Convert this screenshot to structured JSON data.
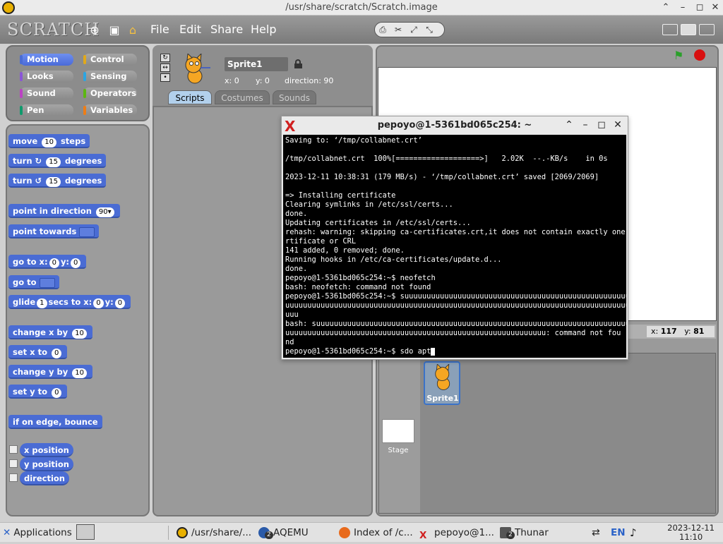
{
  "window": {
    "title": "/usr/share/scratch/Scratch.image",
    "controls": [
      "⌃",
      "–",
      "◻",
      "✕"
    ]
  },
  "scratch": {
    "logo": "SCRATCH",
    "menus": [
      "File",
      "Edit",
      "Share",
      "Help"
    ],
    "categories": [
      "Motion",
      "Control",
      "Looks",
      "Sensing",
      "Sound",
      "Operators",
      "Pen",
      "Variables"
    ],
    "category_colors": [
      "#4a6cd4",
      "#e1a91a",
      "#8a55d7",
      "#2ca5e2",
      "#bb42c3",
      "#5cb712",
      "#0e9a6c",
      "#ee7d16"
    ],
    "blocks": {
      "move": {
        "pre": "move",
        "val": "10",
        "post": "steps"
      },
      "turn_cw": {
        "pre": "turn ↻",
        "val": "15",
        "post": "degrees"
      },
      "turn_ccw": {
        "pre": "turn ↺",
        "val": "15",
        "post": "degrees"
      },
      "point_dir": {
        "pre": "point in direction",
        "val": "90▾"
      },
      "point_towards": {
        "pre": "point towards"
      },
      "goto_xy": {
        "pre": "go to x:",
        "x": "0",
        "mid": "y:",
        "y": "0"
      },
      "goto": {
        "pre": "go to"
      },
      "glide": {
        "pre": "glide",
        "val": "1",
        "mid": "secs to x:",
        "x": "0",
        "mid2": "y:",
        "y": "0"
      },
      "change_x": {
        "pre": "change x by",
        "val": "10"
      },
      "set_x": {
        "pre": "set x to",
        "val": "0"
      },
      "change_y": {
        "pre": "change y by",
        "val": "10"
      },
      "set_y": {
        "pre": "set y to",
        "val": "0"
      },
      "bounce": {
        "pre": "if on edge, bounce"
      },
      "reporters": [
        "x position",
        "y position",
        "direction"
      ]
    },
    "sprite": {
      "name": "Sprite1",
      "x": "x: 0",
      "y": "y: 0",
      "direction": "direction: 90"
    },
    "tabs": [
      "Scripts",
      "Costumes",
      "Sounds"
    ],
    "stage_coords": {
      "x_label": "x:",
      "x": "117",
      "y_label": "y:",
      "y": "81"
    },
    "sprite_thumb_label": "Sprite1",
    "stage_label": "Stage"
  },
  "terminal": {
    "title": "pepoyo@1-5361bd065c254: ~",
    "lines": [
      "Saving to: ‘/tmp/collabnet.crt’",
      "",
      "/tmp/collabnet.crt  100%[===================>]   2.02K  --.-KB/s    in 0s",
      "",
      "2023-12-11 10:38:31 (179 MB/s) - ‘/tmp/collabnet.crt’ saved [2069/2069]",
      "",
      "=> Installing certificate",
      "Clearing symlinks in /etc/ssl/certs...",
      "done.",
      "Updating certificates in /etc/ssl/certs...",
      "rehash: warning: skipping ca-certificates.crt,it does not contain exactly one ce",
      "rtificate or CRL",
      "141 added, 0 removed; done.",
      "Running hooks in /etc/ca-certificates/update.d...",
      "done.",
      "pepoyo@1-5361bd065c254:~$ neofetch",
      "bash: neofetch: command not found",
      "pepoyo@1-5361bd065c254:~$ suuuuuuuuuuuuuuuuuuuuuuuuuuuuuuuuuuuuuuuuuuuuuuuuuuuuuu",
      "uuuuuuuuuuuuuuuuuuuuuuuuuuuuuuuuuuuuuuuuuuuuuuuuuuuuuuuuuuuuuuuuuuuuuuuuuuuuuuuu",
      "uuu",
      "bash: suuuuuuuuuuuuuuuuuuuuuuuuuuuuuuuuuuuuuuuuuuuuuuuuuuuuuuuuuuuuuuuuuuuuuuuuuu",
      "uuuuuuuuuuuuuuuuuuuuuuuuuuuuuuuuuuuuuuuuuuuuuuuuuuuuuuuuuuu: command not fou",
      "nd"
    ],
    "prompt": "pepoyo@1-5361bd065c254:~$ sdo apt"
  },
  "taskbar": {
    "applications": "Applications",
    "items": [
      "/usr/share/...",
      "AQEMU",
      "Index of /c...",
      "pepoyo@1...",
      "Thunar"
    ],
    "badges": [
      "2",
      "2"
    ],
    "lang": "EN",
    "date": "2023-12-11",
    "time": "11:10"
  }
}
